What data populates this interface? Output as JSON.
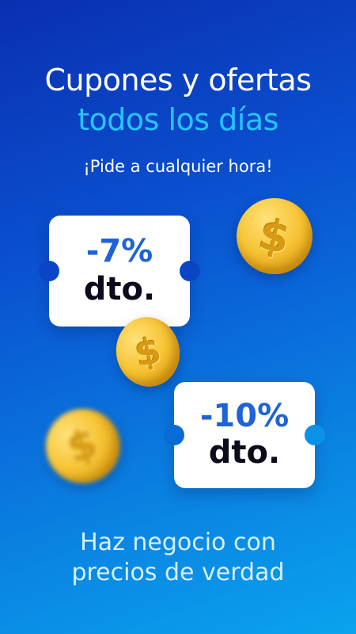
{
  "heading": {
    "line1": "Cupones y ofertas",
    "line2": "todos los días"
  },
  "tagline": "¡Pide a cualquier hora!",
  "coupons": [
    {
      "discount": "-7%",
      "label": "dto."
    },
    {
      "discount": "-10%",
      "label": "dto."
    }
  ],
  "coins": {
    "symbol": "$",
    "icon": "dollar-coin-icon"
  },
  "footer": {
    "line1": "Haz negocio con",
    "line2": "precios de verdad"
  },
  "colors": {
    "background_top": "#0a2fb0",
    "background_bottom": "#0aa3ee",
    "accent": "#29c3ff",
    "discount_text": "#1f63d6",
    "coin_gold": "#f7c536"
  }
}
